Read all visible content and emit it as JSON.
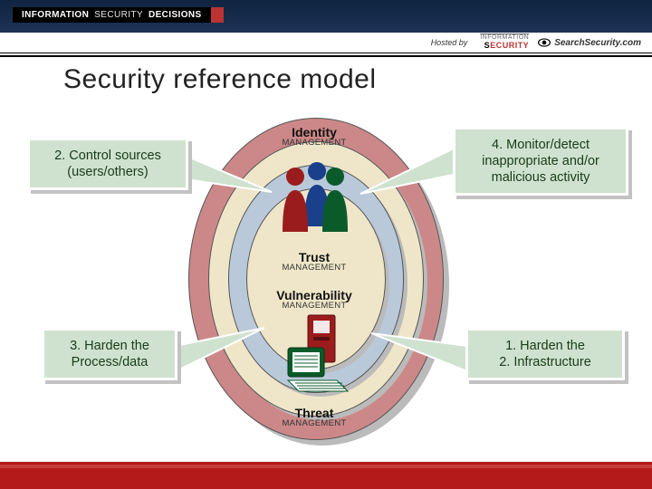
{
  "brand": {
    "word1": "INFORMATION",
    "word2": "SECURITY",
    "word3": "DECISIONS"
  },
  "hosted": {
    "label": "Hosted by",
    "sponsor_small": "INFORMATION",
    "sponsor_big": "SECURITY",
    "search_name": "SearchSecurity.com"
  },
  "title": "Security reference model",
  "rings": {
    "identity": {
      "t": "Identity",
      "m": "MANAGEMENT"
    },
    "trust": {
      "t": "Trust",
      "m": "MANAGEMENT"
    },
    "vulnerability": {
      "t": "Vulnerability",
      "m": "MANAGEMENT"
    },
    "threat": {
      "t": "Threat",
      "m": "MANAGEMENT"
    }
  },
  "callouts": {
    "c2": "2. Control sources (users/others)",
    "c4": "4. Monitor/detect inappropriate and/or malicious activity",
    "c3": "3. Harden the Process/data",
    "c1_line1": "1. Harden the",
    "c1_line2": "2. Infrastructure"
  },
  "colors": {
    "accent": "#b31b1b",
    "callout_bg": "#cfe2cf"
  }
}
